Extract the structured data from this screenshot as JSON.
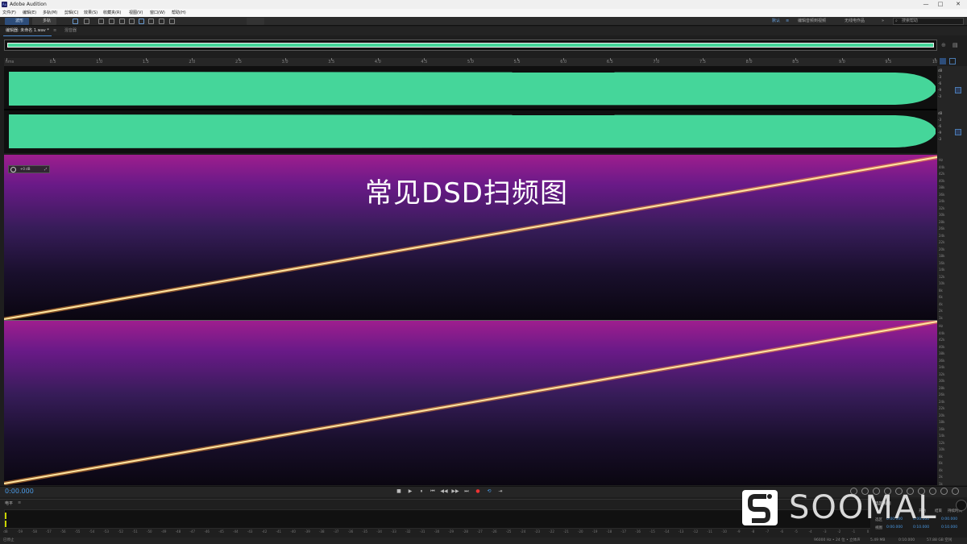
{
  "app": {
    "title": "Adobe Audition",
    "icon": "Au"
  },
  "window_controls": [
    "—",
    "□",
    "✕"
  ],
  "menu": [
    "文件(F)",
    "编辑(E)",
    "多轨(M)",
    "剪辑(C)",
    "效果(S)",
    "收藏夹(R)",
    "视图(V)",
    "窗口(W)",
    "帮助(H)"
  ],
  "toolbar": {
    "waveform": "波形",
    "multitrack": "多轨",
    "ws_default": "默认",
    "ws_edit": "编辑音频到视频",
    "ws_radio": "无线电作品",
    "search_placeholder": "搜索帮助"
  },
  "tabs": {
    "editor": "编辑器: 未命名 1.wav *",
    "mixer": "混音器"
  },
  "ruler": [
    "hms",
    "0.5",
    "1.0",
    "1.5",
    "2.0",
    "2.5",
    "3.0",
    "3.5",
    "4.0",
    "4.5",
    "5.0",
    "5.5",
    "6.0",
    "6.5",
    "7.0",
    "7.5",
    "8.0",
    "8.5",
    "9.0",
    "9.5",
    "10"
  ],
  "db_scale_top": [
    "dB",
    "-3",
    "-6",
    "-9",
    "-3"
  ],
  "db_scale_bottom": [
    "dB",
    "-3",
    "-6",
    "-9",
    "-3"
  ],
  "hud": {
    "gain": "+0 dB"
  },
  "overlay_title": "常见DSD扫频图",
  "freq_scale_top": [
    "Hz",
    "44k",
    "42k",
    "40k",
    "38k",
    "36k",
    "34k",
    "32k",
    "30k",
    "28k",
    "26k",
    "24k",
    "22k",
    "20k",
    "18k",
    "16k",
    "14k",
    "12k",
    "10k",
    "8k",
    "6k",
    "4k",
    "2k",
    "1k"
  ],
  "freq_scale_bottom": [
    "Hz",
    "44k",
    "42k",
    "40k",
    "38k",
    "36k",
    "34k",
    "32k",
    "30k",
    "28k",
    "26k",
    "24k",
    "22k",
    "20k",
    "18k",
    "16k",
    "14k",
    "12k",
    "10k",
    "8k",
    "6k",
    "4k",
    "2k",
    "1k"
  ],
  "transport": {
    "timecode": "0:00.000",
    "buttons": [
      "■",
      "▶",
      "⏸",
      "⏮",
      "◀◀",
      "▶▶",
      "⏭",
      "●",
      "⟲",
      "⇥"
    ]
  },
  "levels": {
    "title": "电平",
    "scale": [
      "dB",
      "-59",
      "-58",
      "-57",
      "-56",
      "-55",
      "-54",
      "-53",
      "-52",
      "-51",
      "-50",
      "-49",
      "-48",
      "-47",
      "-46",
      "-45",
      "-44",
      "-43",
      "-42",
      "-41",
      "-40",
      "-39",
      "-38",
      "-37",
      "-36",
      "-35",
      "-34",
      "-33",
      "-32",
      "-31",
      "-30",
      "-29",
      "-28",
      "-27",
      "-26",
      "-25",
      "-24",
      "-23",
      "-22",
      "-21",
      "-20",
      "-19",
      "-18",
      "-17",
      "-16",
      "-15",
      "-14",
      "-13",
      "-12",
      "-11",
      "-10",
      "-9",
      "-8",
      "-7",
      "-6",
      "-5",
      "-4",
      "-3",
      "-2",
      "-1",
      "0"
    ]
  },
  "selection": {
    "title": "选区/视图",
    "col_start": "开始",
    "col_end": "结束",
    "col_duration": "持续时间",
    "row_sel": "选区",
    "row_view": "视图",
    "sel_start": "0:00.000",
    "sel_end": "0:00.000",
    "sel_dur": "0:00.000",
    "view_start": "0:00.000",
    "view_end": "0:10.000",
    "view_dur": "0:10.000"
  },
  "status": {
    "left": "已停止",
    "rate": "96000 Hz • 24 位 • 立体声",
    "size": "5.49 MB",
    "dur": "0:10.000",
    "free": "57.88 GB 空闲"
  },
  "watermark": "SOOMAL",
  "colors": {
    "waveform": "#45d69a",
    "accent": "#4a9ae6",
    "sweep": "#ffd27a"
  }
}
